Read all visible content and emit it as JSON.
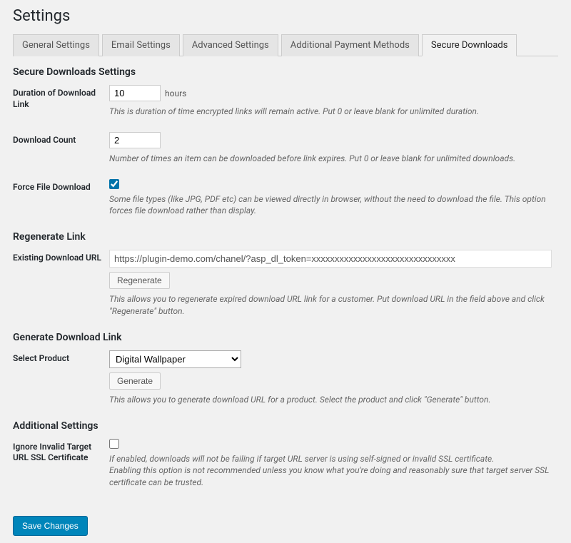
{
  "pageTitle": "Settings",
  "tabs": {
    "general": "General Settings",
    "email": "Email Settings",
    "advanced": "Advanced Settings",
    "payment": "Additional Payment Methods",
    "secure": "Secure Downloads"
  },
  "sections": {
    "secureDownloads": {
      "heading": "Secure Downloads Settings",
      "duration": {
        "label": "Duration of Download Link",
        "value": "10",
        "unit": "hours",
        "desc": "This is duration of time encrypted links will remain active. Put 0 or leave blank for unlimited duration."
      },
      "count": {
        "label": "Download Count",
        "value": "2",
        "desc": "Number of times an item can be downloaded before link expires. Put 0 or leave blank for unlimited downloads."
      },
      "force": {
        "label": "Force File Download",
        "desc": "Some file types (like JPG, PDF etc) can be viewed directly in browser, without the need to download the file. This option forces file download rather than display."
      }
    },
    "regenerate": {
      "heading": "Regenerate Link",
      "existing": {
        "label": "Existing Download URL",
        "value": "https://plugin-demo.com/chanel/?asp_dl_token=xxxxxxxxxxxxxxxxxxxxxxxxxxxxxxx",
        "button": "Regenerate",
        "desc": "This allows you to regenerate expired download URL link for a customer. Put download URL in the field above and click \"Regenerate\" button."
      }
    },
    "generate": {
      "heading": "Generate Download Link",
      "select": {
        "label": "Select Product",
        "value": "Digital Wallpaper",
        "button": "Generate",
        "desc": "This allows you to generate download URL for a product. Select the product and click \"Generate\" button."
      }
    },
    "additional": {
      "heading": "Additional Settings",
      "ignoreSsl": {
        "label": "Ignore Invalid Target URL SSL Certificate",
        "desc1": "If enabled, downloads will not be failing if target URL server is using self-signed or invalid SSL certificate.",
        "desc2": "Enabling this option is not recommended unless you know what you're doing and reasonably sure that target server SSL certificate can be trusted."
      }
    }
  },
  "saveButton": "Save Changes"
}
